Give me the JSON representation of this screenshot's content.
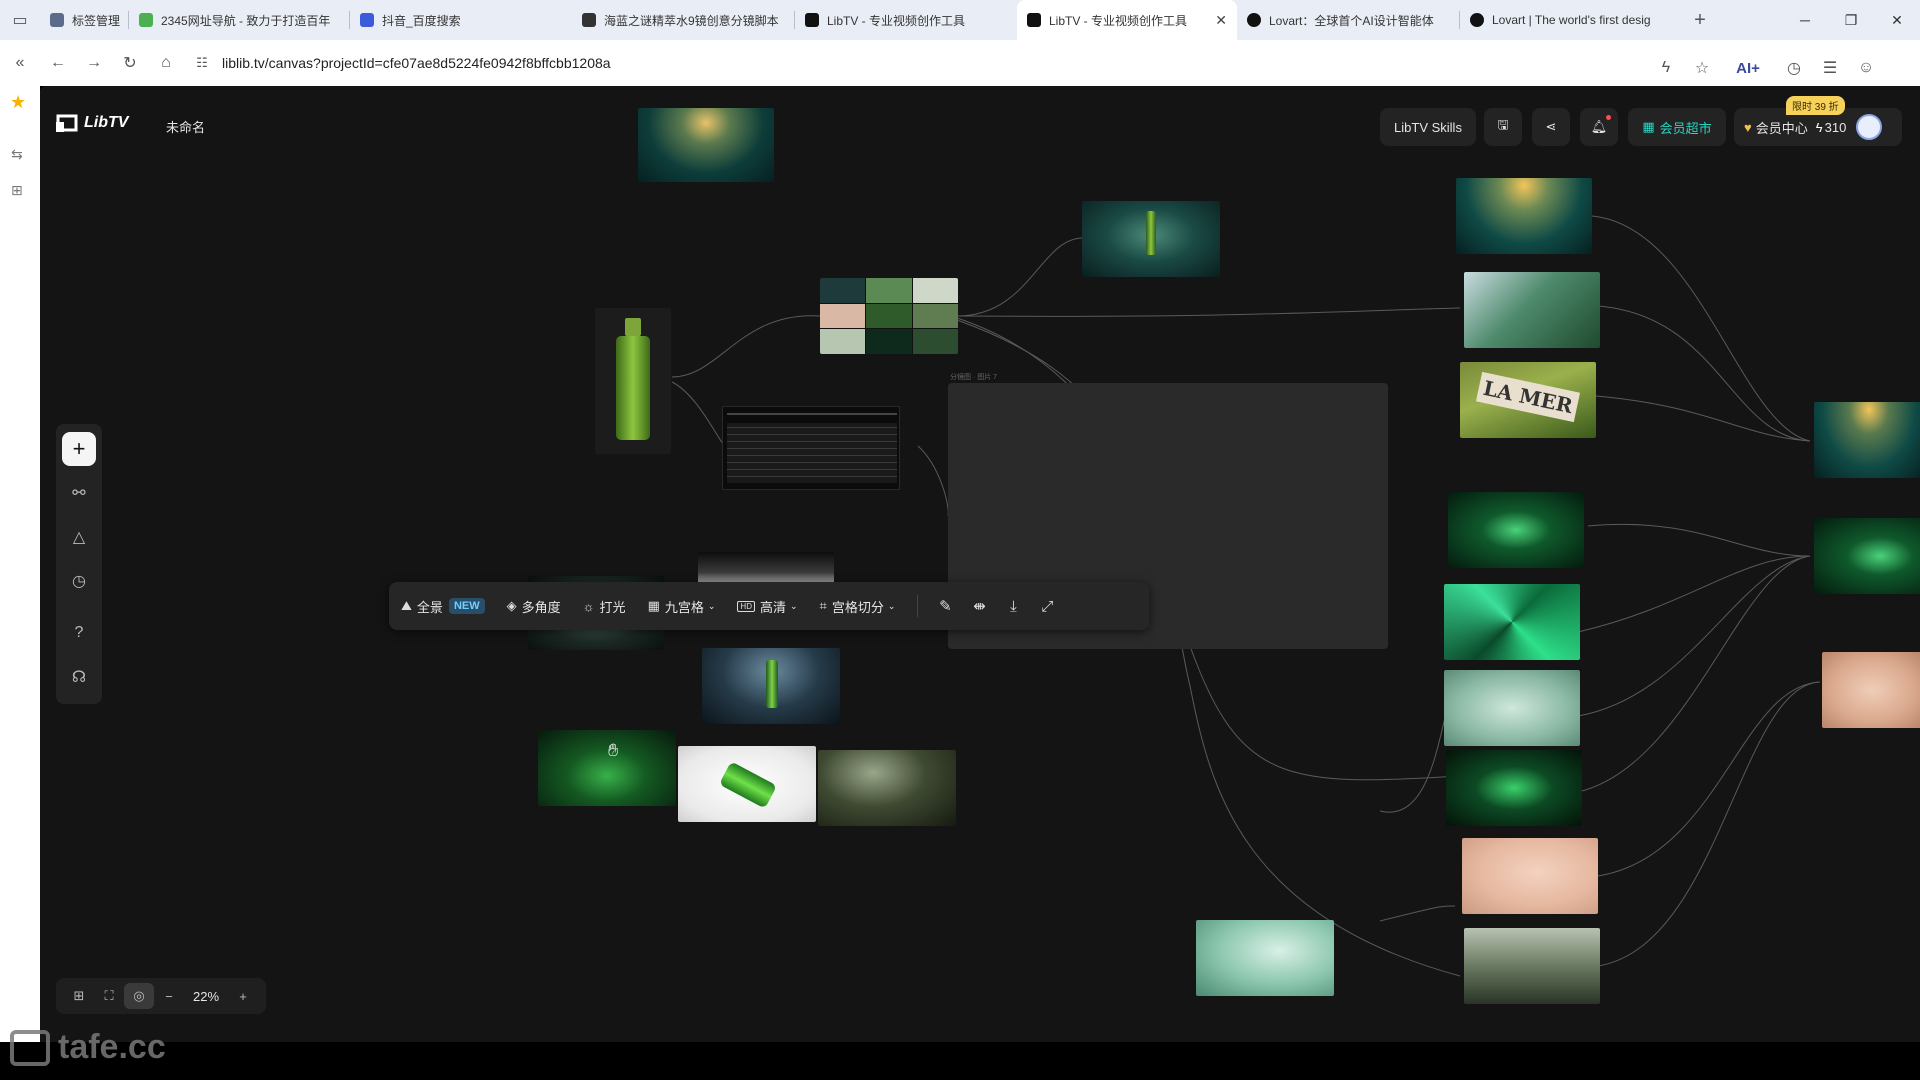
{
  "browser": {
    "tabs": [
      {
        "label": "标签管理",
        "color": "#5a6b8c"
      },
      {
        "label": "2345网址导航 - 致力于打造百年",
        "color": "#4caf50"
      },
      {
        "label": "抖音_百度搜索",
        "color": "#3b5bdb"
      },
      {
        "label": "海蓝之谜精萃水9镜创意分镜脚本",
        "color": "#333333"
      },
      {
        "label": "LibTV - 专业视频创作工具",
        "color": "#111111"
      },
      {
        "label": "LibTV - 专业视频创作工具",
        "color": "#111111"
      },
      {
        "label": "Lovart：全球首个AI设计智能体",
        "color": "#111111"
      },
      {
        "label": "Lovart | The world's first desig",
        "color": "#111111"
      }
    ],
    "active_tab_index": 5,
    "url": "liblib.tv/canvas?projectId=cfe07ae8d5224fe0942f8bffcbb1208a",
    "ai_label": "AI+"
  },
  "app": {
    "logo_text": "LibTV",
    "project_name": "未命名",
    "skills_label": "LibTV Skills",
    "market_label": "会员超市",
    "member_label": "会员中心",
    "promo_badge": "限时 39 折",
    "credits": "310",
    "accent_color": "#2bd4c0"
  },
  "placeholder_card_label": "分镜图 · 图片 7",
  "floating_toolbar": {
    "panorama": "全景",
    "new_badge": "NEW",
    "multi_angle": "多角度",
    "lighting": "打光",
    "nine_grid": "九宫格",
    "hd": "高清",
    "grid_cut": "宫格切分"
  },
  "zoom": {
    "level": "22%"
  },
  "watermark": "tafe.cc",
  "icons": [
    "plus-icon",
    "workflow-icon",
    "shapes-icon",
    "history-icon",
    "help-icon",
    "headset-icon",
    "brush-icon",
    "split-icon",
    "download-icon",
    "expand-icon",
    "save-icon",
    "share-icon",
    "bell-icon"
  ]
}
